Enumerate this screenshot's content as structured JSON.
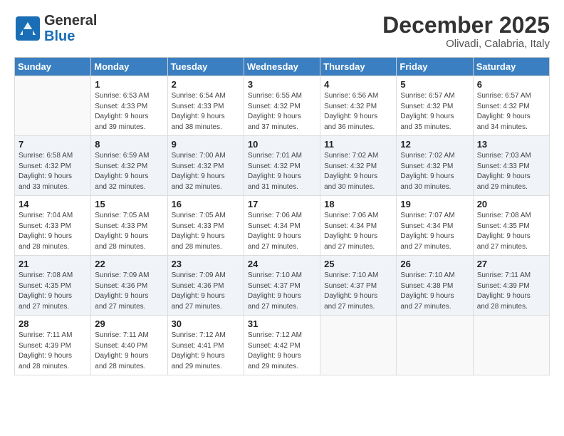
{
  "logo": {
    "line1": "General",
    "line2": "Blue"
  },
  "header": {
    "month": "December 2025",
    "location": "Olivadi, Calabria, Italy"
  },
  "days_of_week": [
    "Sunday",
    "Monday",
    "Tuesday",
    "Wednesday",
    "Thursday",
    "Friday",
    "Saturday"
  ],
  "weeks": [
    [
      {
        "day": "",
        "info": ""
      },
      {
        "day": "1",
        "info": "Sunrise: 6:53 AM\nSunset: 4:33 PM\nDaylight: 9 hours\nand 39 minutes."
      },
      {
        "day": "2",
        "info": "Sunrise: 6:54 AM\nSunset: 4:33 PM\nDaylight: 9 hours\nand 38 minutes."
      },
      {
        "day": "3",
        "info": "Sunrise: 6:55 AM\nSunset: 4:32 PM\nDaylight: 9 hours\nand 37 minutes."
      },
      {
        "day": "4",
        "info": "Sunrise: 6:56 AM\nSunset: 4:32 PM\nDaylight: 9 hours\nand 36 minutes."
      },
      {
        "day": "5",
        "info": "Sunrise: 6:57 AM\nSunset: 4:32 PM\nDaylight: 9 hours\nand 35 minutes."
      },
      {
        "day": "6",
        "info": "Sunrise: 6:57 AM\nSunset: 4:32 PM\nDaylight: 9 hours\nand 34 minutes."
      }
    ],
    [
      {
        "day": "7",
        "info": "Sunrise: 6:58 AM\nSunset: 4:32 PM\nDaylight: 9 hours\nand 33 minutes."
      },
      {
        "day": "8",
        "info": "Sunrise: 6:59 AM\nSunset: 4:32 PM\nDaylight: 9 hours\nand 32 minutes."
      },
      {
        "day": "9",
        "info": "Sunrise: 7:00 AM\nSunset: 4:32 PM\nDaylight: 9 hours\nand 32 minutes."
      },
      {
        "day": "10",
        "info": "Sunrise: 7:01 AM\nSunset: 4:32 PM\nDaylight: 9 hours\nand 31 minutes."
      },
      {
        "day": "11",
        "info": "Sunrise: 7:02 AM\nSunset: 4:32 PM\nDaylight: 9 hours\nand 30 minutes."
      },
      {
        "day": "12",
        "info": "Sunrise: 7:02 AM\nSunset: 4:32 PM\nDaylight: 9 hours\nand 30 minutes."
      },
      {
        "day": "13",
        "info": "Sunrise: 7:03 AM\nSunset: 4:33 PM\nDaylight: 9 hours\nand 29 minutes."
      }
    ],
    [
      {
        "day": "14",
        "info": "Sunrise: 7:04 AM\nSunset: 4:33 PM\nDaylight: 9 hours\nand 28 minutes."
      },
      {
        "day": "15",
        "info": "Sunrise: 7:05 AM\nSunset: 4:33 PM\nDaylight: 9 hours\nand 28 minutes."
      },
      {
        "day": "16",
        "info": "Sunrise: 7:05 AM\nSunset: 4:33 PM\nDaylight: 9 hours\nand 28 minutes."
      },
      {
        "day": "17",
        "info": "Sunrise: 7:06 AM\nSunset: 4:34 PM\nDaylight: 9 hours\nand 27 minutes."
      },
      {
        "day": "18",
        "info": "Sunrise: 7:06 AM\nSunset: 4:34 PM\nDaylight: 9 hours\nand 27 minutes."
      },
      {
        "day": "19",
        "info": "Sunrise: 7:07 AM\nSunset: 4:34 PM\nDaylight: 9 hours\nand 27 minutes."
      },
      {
        "day": "20",
        "info": "Sunrise: 7:08 AM\nSunset: 4:35 PM\nDaylight: 9 hours\nand 27 minutes."
      }
    ],
    [
      {
        "day": "21",
        "info": "Sunrise: 7:08 AM\nSunset: 4:35 PM\nDaylight: 9 hours\nand 27 minutes."
      },
      {
        "day": "22",
        "info": "Sunrise: 7:09 AM\nSunset: 4:36 PM\nDaylight: 9 hours\nand 27 minutes."
      },
      {
        "day": "23",
        "info": "Sunrise: 7:09 AM\nSunset: 4:36 PM\nDaylight: 9 hours\nand 27 minutes."
      },
      {
        "day": "24",
        "info": "Sunrise: 7:10 AM\nSunset: 4:37 PM\nDaylight: 9 hours\nand 27 minutes."
      },
      {
        "day": "25",
        "info": "Sunrise: 7:10 AM\nSunset: 4:37 PM\nDaylight: 9 hours\nand 27 minutes."
      },
      {
        "day": "26",
        "info": "Sunrise: 7:10 AM\nSunset: 4:38 PM\nDaylight: 9 hours\nand 27 minutes."
      },
      {
        "day": "27",
        "info": "Sunrise: 7:11 AM\nSunset: 4:39 PM\nDaylight: 9 hours\nand 28 minutes."
      }
    ],
    [
      {
        "day": "28",
        "info": "Sunrise: 7:11 AM\nSunset: 4:39 PM\nDaylight: 9 hours\nand 28 minutes."
      },
      {
        "day": "29",
        "info": "Sunrise: 7:11 AM\nSunset: 4:40 PM\nDaylight: 9 hours\nand 28 minutes."
      },
      {
        "day": "30",
        "info": "Sunrise: 7:12 AM\nSunset: 4:41 PM\nDaylight: 9 hours\nand 29 minutes."
      },
      {
        "day": "31",
        "info": "Sunrise: 7:12 AM\nSunset: 4:42 PM\nDaylight: 9 hours\nand 29 minutes."
      },
      {
        "day": "",
        "info": ""
      },
      {
        "day": "",
        "info": ""
      },
      {
        "day": "",
        "info": ""
      }
    ]
  ]
}
